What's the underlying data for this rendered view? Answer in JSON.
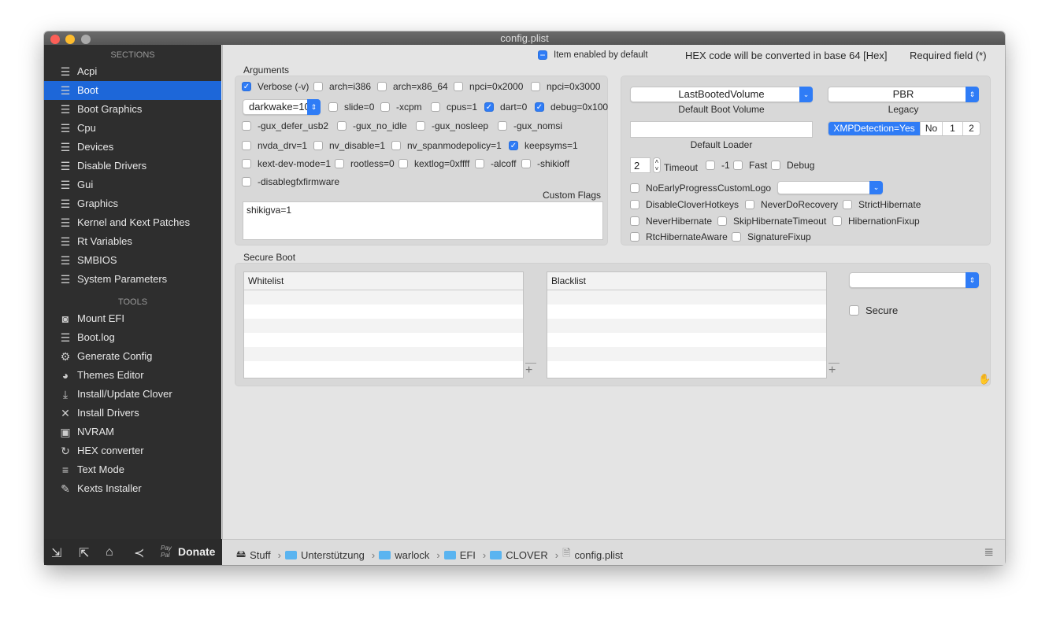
{
  "window": {
    "title": "config.plist"
  },
  "sidebar": {
    "sections_header": "SECTIONS",
    "sections": [
      {
        "label": "Acpi"
      },
      {
        "label": "Boot",
        "selected": true
      },
      {
        "label": "Boot Graphics"
      },
      {
        "label": "Cpu"
      },
      {
        "label": "Devices"
      },
      {
        "label": "Disable Drivers"
      },
      {
        "label": "Gui"
      },
      {
        "label": "Graphics"
      },
      {
        "label": "Kernel and Kext Patches"
      },
      {
        "label": "Rt Variables"
      },
      {
        "label": "SMBIOS"
      },
      {
        "label": "System Parameters"
      }
    ],
    "tools_header": "TOOLS",
    "tools": [
      {
        "label": "Mount EFI",
        "icon": "disk-icon"
      },
      {
        "label": "Boot.log",
        "icon": "log-icon"
      },
      {
        "label": "Generate Config",
        "icon": "gears-icon"
      },
      {
        "label": "Themes Editor",
        "icon": "palette-icon"
      },
      {
        "label": "Install/Update Clover",
        "icon": "download-icon"
      },
      {
        "label": "Install Drivers",
        "icon": "tools-icon"
      },
      {
        "label": "NVRAM",
        "icon": "chip-icon"
      },
      {
        "label": "HEX converter",
        "icon": "refresh-icon"
      },
      {
        "label": "Text Mode",
        "icon": "text-icon"
      },
      {
        "label": "Kexts Installer",
        "icon": "plug-icon"
      }
    ],
    "donate_label": "Donate",
    "paypal": "Pay Pal"
  },
  "header": {
    "item_enabled": "Item enabled by default",
    "hex_note": "HEX code will be converted in base 64 [Hex]",
    "required": "Required field (*)"
  },
  "arguments": {
    "title": "Arguments",
    "darkwake": "darkwake=10",
    "flags": [
      {
        "label": "Verbose (-v)",
        "checked": true
      },
      {
        "label": "arch=i386",
        "checked": false
      },
      {
        "label": "arch=x86_64",
        "checked": false
      },
      {
        "label": "npci=0x2000",
        "checked": false
      },
      {
        "label": "npci=0x3000",
        "checked": false
      },
      {
        "label": "slide=0",
        "checked": false
      },
      {
        "label": "-xcpm",
        "checked": false
      },
      {
        "label": "cpus=1",
        "checked": false
      },
      {
        "label": "dart=0",
        "checked": true
      },
      {
        "label": "debug=0x100",
        "checked": true
      },
      {
        "label": "-gux_defer_usb2",
        "checked": false
      },
      {
        "label": "-gux_no_idle",
        "checked": false
      },
      {
        "label": "-gux_nosleep",
        "checked": false
      },
      {
        "label": "-gux_nomsi",
        "checked": false
      },
      {
        "label": "nvda_drv=1",
        "checked": false
      },
      {
        "label": "nv_disable=1",
        "checked": false
      },
      {
        "label": "nv_spanmodepolicy=1",
        "checked": false
      },
      {
        "label": "keepsyms=1",
        "checked": true
      },
      {
        "label": "kext-dev-mode=1",
        "checked": false
      },
      {
        "label": "rootless=0",
        "checked": false
      },
      {
        "label": "kextlog=0xffff",
        "checked": false
      },
      {
        "label": "-alcoff",
        "checked": false
      },
      {
        "label": "-shikioff",
        "checked": false
      },
      {
        "label": "-disablegfxfirmware",
        "checked": false
      }
    ],
    "custom_flags_label": "Custom Flags",
    "custom_flags_value": "shikigva=1"
  },
  "boot": {
    "default_volume": "LastBootedVolume",
    "default_volume_label": "Default Boot Volume",
    "legacy": "PBR",
    "legacy_label": "Legacy",
    "default_loader_label": "Default Loader",
    "default_loader_value": "",
    "xmp": [
      {
        "label": "XMPDetection=Yes",
        "selected": true
      },
      {
        "label": "No"
      },
      {
        "label": "1"
      },
      {
        "label": "2"
      }
    ],
    "timeout_value": "2",
    "timeout_label": "Timeout",
    "custom_logo_label": "CustomLogo",
    "options": [
      {
        "label": "-1",
        "checked": false
      },
      {
        "label": "Fast",
        "checked": false
      },
      {
        "label": "Debug",
        "checked": false
      },
      {
        "label": "NoEarlyProgress",
        "checked": false
      },
      {
        "label": "DisableCloverHotkeys",
        "checked": false
      },
      {
        "label": "NeverDoRecovery",
        "checked": false
      },
      {
        "label": "StrictHibernate",
        "checked": false
      },
      {
        "label": "NeverHibernate",
        "checked": false
      },
      {
        "label": "SkipHibernateTimeout",
        "checked": false
      },
      {
        "label": "HibernationFixup",
        "checked": false
      },
      {
        "label": "RtcHibernateAware",
        "checked": false
      },
      {
        "label": "SignatureFixup",
        "checked": false
      }
    ]
  },
  "secure_boot": {
    "title": "Secure Boot",
    "whitelist": "Whitelist",
    "blacklist": "Blacklist",
    "secure_label": "Secure",
    "secure_checked": false,
    "policy": ""
  },
  "breadcrumb": [
    "Stuff",
    "Unterstützung",
    "warlock",
    "EFI",
    "CLOVER",
    "config.plist"
  ]
}
